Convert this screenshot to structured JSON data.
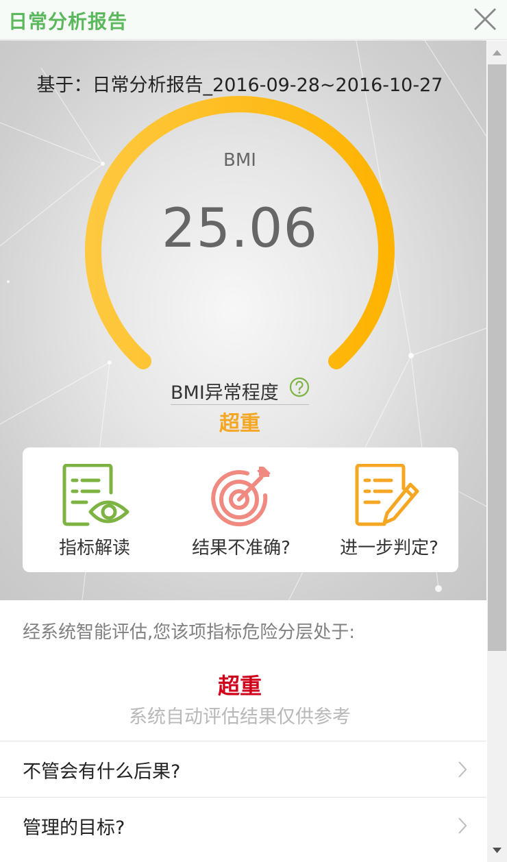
{
  "window": {
    "title": "日常分析报告",
    "close_icon": "close-icon"
  },
  "report": {
    "based_on": "基于：日常分析报告_2016-09-28~2016-10-27",
    "metric_label": "BMI",
    "metric_value": "25.06",
    "gauge_color": "#fdb826",
    "degree_label": "BMI异常程度",
    "help_icon": "question-circle-icon",
    "level": "超重",
    "level_color": "#f5a623"
  },
  "actions": [
    {
      "label": "指标解读",
      "icon": "document-eye-icon",
      "color": "#7cb342"
    },
    {
      "label": "结果不准确?",
      "icon": "target-arrow-icon",
      "color": "#f08a80"
    },
    {
      "label": "进一步判定?",
      "icon": "document-pencil-icon",
      "color": "#f5a623"
    }
  ],
  "assessment": {
    "intro": "经系统智能评估,您该项指标危险分层处于:",
    "result": "超重",
    "result_color": "#d0021b",
    "note": "系统自动评估结果仅供参考"
  },
  "list": [
    {
      "label": "不管会有什么后果?"
    },
    {
      "label": "管理的目标?"
    }
  ]
}
